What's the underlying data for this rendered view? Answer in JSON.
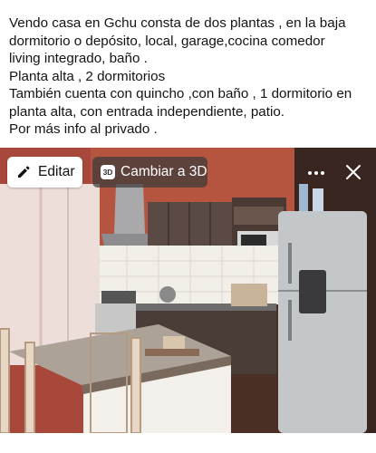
{
  "post": {
    "caption_lines": [
      "Vendo casa en Gchu consta de dos plantas , en la baja",
      "dormitorio o depósito, local, garage,cocina comedor",
      "living integrado, baño .",
      "Planta alta , 2 dormitorios",
      "También cuenta con quincho ,con baño , 1 dormitorio en",
      "planta alta, con entrada independiente, patio.",
      "Por más info al privado ."
    ]
  },
  "photo_toolbar": {
    "edit_label": "Editar",
    "view_3d_label": "Cambiar a 3D",
    "badge_3d": "3D",
    "edit_icon": "pencil-icon",
    "more_icon": "more-dots-icon",
    "close_icon": "close-icon"
  }
}
